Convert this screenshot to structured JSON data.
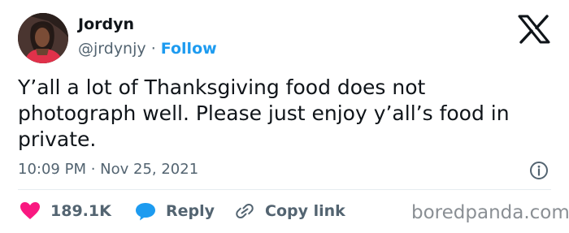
{
  "tweet": {
    "author_name": "Jordyn",
    "author_handle": "@jrdynjy",
    "separator": "·",
    "follow_label": "Follow",
    "text": "Y’all a lot of Thanksgiving food does not photograph well. Please just enjoy y’all’s food in private.",
    "timestamp": "10:09 PM · Nov 25, 2021"
  },
  "actions": {
    "like_count": "189.1K",
    "reply_label": "Reply",
    "copy_link_label": "Copy link"
  },
  "watermark": "boredpanda.com",
  "icons": {
    "platform_logo": "x-logo-icon",
    "info": "info-icon",
    "like": "heart-icon",
    "reply": "speech-bubble-icon",
    "copy_link": "link-icon"
  },
  "colors": {
    "follow": "#1d9bf0",
    "heart": "#f91880",
    "reply_bubble": "#1d9bf0",
    "secondary_text": "#536471",
    "watermark": "#8a8f94"
  }
}
